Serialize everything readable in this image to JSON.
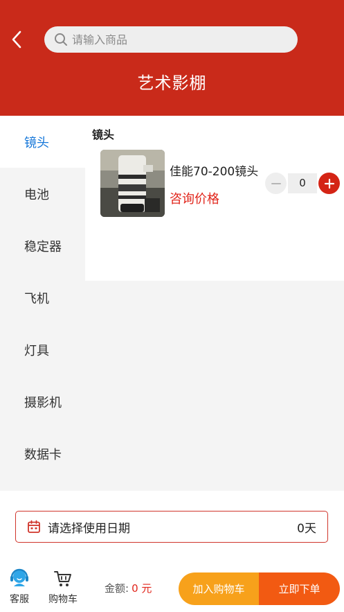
{
  "header": {
    "title": "艺术影棚",
    "search_placeholder": "请输入商品",
    "background_color": "#c92a1a"
  },
  "sidebar": {
    "items": [
      {
        "label": "镜头",
        "active": true
      },
      {
        "label": "电池",
        "active": false
      },
      {
        "label": "稳定器",
        "active": false
      },
      {
        "label": "飞机",
        "active": false
      },
      {
        "label": "灯具",
        "active": false
      },
      {
        "label": "摄影机",
        "active": false
      },
      {
        "label": "数据卡",
        "active": false
      }
    ],
    "active_color": "#1677d9"
  },
  "content": {
    "section_title": "镜头",
    "products": [
      {
        "name": "佳能70-200镜头",
        "price_text": "咨询价格",
        "quantity": "0"
      }
    ]
  },
  "date_bar": {
    "label": "请选择使用日期",
    "days": "0天"
  },
  "bottom_bar": {
    "service_label": "客服",
    "cart_label": "购物车",
    "amount_label": "金额:",
    "amount_value": "0 元",
    "add_to_cart_label": "加入购物车",
    "order_now_label": "立即下单",
    "accent_orange": "#f7a11b",
    "accent_red": "#f25a12"
  }
}
